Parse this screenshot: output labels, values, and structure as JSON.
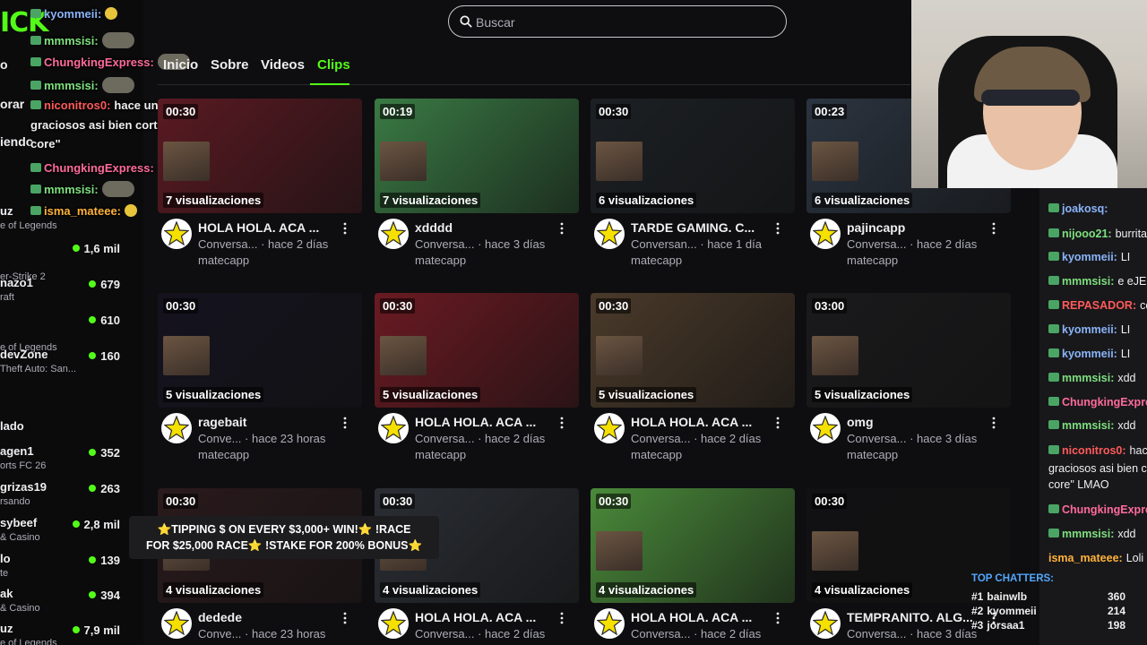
{
  "sidebar": {
    "logo_fragment": "ICK",
    "nav_fragments": [
      "o",
      "orar",
      "iendo"
    ],
    "channels": [
      {
        "name": "uz",
        "category": "e of Legends",
        "viewers": ""
      },
      {
        "name": "",
        "category": "",
        "viewers": "1,6 mil"
      },
      {
        "name": "",
        "category": "er-Strike 2",
        "viewers": ""
      },
      {
        "name": "nazo1",
        "category": "raft",
        "viewers": "679"
      },
      {
        "name": "",
        "category": "",
        "viewers": "610"
      },
      {
        "name": "",
        "category": "e of Legends",
        "viewers": ""
      },
      {
        "name": "devZone",
        "category": "Theft Auto: San...",
        "viewers": "160"
      },
      {
        "name": "lado",
        "category": "",
        "viewers": ""
      },
      {
        "name": "agen1",
        "category": "orts FC 26",
        "viewers": "352"
      },
      {
        "name": "grizas19",
        "category": "rsando",
        "viewers": "263"
      },
      {
        "name": "sybeef",
        "category": "& Casino",
        "viewers": "2,8 mil"
      },
      {
        "name": "lo",
        "category": "te",
        "viewers": "139"
      },
      {
        "name": "ak",
        "category": "& Casino",
        "viewers": "394"
      },
      {
        "name": "uz",
        "category": "e of Legends",
        "viewers": "7,9 mil"
      }
    ]
  },
  "chat_overlay": {
    "lines": [
      {
        "user": "kyommeii:",
        "color": "#8ab4f8",
        "text": ""
      },
      {
        "user": "mmmsisi:",
        "color": "#7ee07e",
        "text": ""
      },
      {
        "user": "ChungkingExpress:",
        "color": "#ff6b9a",
        "text": ""
      },
      {
        "user": "mmmsisi:",
        "color": "#7ee07e",
        "text": ""
      },
      {
        "user": "niconitros0:",
        "color": "#ff5a5a",
        "text": "hace un recopilado de clips"
      },
      {
        "user": "",
        "color": "#efeff1",
        "text": "graciosos asi bien cortados y pones \"matecap"
      },
      {
        "user": "",
        "color": "#efeff1",
        "text": "core\""
      },
      {
        "user": "ChungkingExpress:",
        "color": "#ff6b9a",
        "text": ""
      },
      {
        "user": "mmmsisi:",
        "color": "#7ee07e",
        "text": ""
      },
      {
        "user": "isma_mateee:",
        "color": "#ffb23a",
        "text": ""
      }
    ]
  },
  "search": {
    "placeholder": "Buscar"
  },
  "tabs": [
    "Inicio",
    "Sobre",
    "Videos",
    "Clips"
  ],
  "active_tab": "Clips",
  "clips": [
    {
      "duration": "00:30",
      "views": "7 visualizaciones",
      "title": "HOLA HOLA. ACA ...",
      "category": "Conversa...",
      "age": "hace 2 días",
      "channel": "matecapp",
      "bg": "#5a1a22"
    },
    {
      "duration": "00:19",
      "views": "7 visualizaciones",
      "title": "xdddd",
      "category": "Conversa...",
      "age": "hace 3 días",
      "channel": "matecapp",
      "bg": "#3a7a44"
    },
    {
      "duration": "00:30",
      "views": "6 visualizaciones",
      "title": "TARDE GAMING. C...",
      "category": "Conversan...",
      "age": "hace 1 día",
      "channel": "matecapp",
      "bg": "#1c2024"
    },
    {
      "duration": "00:23",
      "views": "6 visualizaciones",
      "title": "pajincapp",
      "category": "Conversa...",
      "age": "hace 2 días",
      "channel": "matecapp",
      "bg": "#2b3440"
    },
    {
      "duration": "00:30",
      "views": "5 visualizaciones",
      "title": "ragebait",
      "category": "Conve...",
      "age": "hace 23 horas",
      "channel": "matecapp",
      "bg": "#15121e"
    },
    {
      "duration": "00:30",
      "views": "5 visualizaciones",
      "title": "HOLA HOLA. ACA ...",
      "category": "Conversa...",
      "age": "hace 2 días",
      "channel": "matecapp",
      "bg": "#6a1a22"
    },
    {
      "duration": "00:30",
      "views": "5 visualizaciones",
      "title": "HOLA HOLA. ACA ...",
      "category": "Conversa...",
      "age": "hace 2 días",
      "channel": "matecapp",
      "bg": "#4a3a2a"
    },
    {
      "duration": "03:00",
      "views": "5 visualizaciones",
      "title": "omg",
      "category": "Conversa...",
      "age": "hace 3 días",
      "channel": "matecapp",
      "bg": "#1a1a1c"
    },
    {
      "duration": "00:30",
      "views": "4 visualizaciones",
      "title": "dedede",
      "category": "Conve...",
      "age": "hace 23 horas",
      "channel": "matecapp",
      "bg": "#2a1a1c"
    },
    {
      "duration": "00:30",
      "views": "4 visualizaciones",
      "title": "HOLA HOLA. ACA ...",
      "category": "Conversa...",
      "age": "hace 2 días",
      "channel": "matecapp",
      "bg": "#2a2e34"
    },
    {
      "duration": "00:30",
      "views": "4 visualizaciones",
      "title": "HOLA HOLA. ACA ...",
      "category": "Conversa...",
      "age": "hace 2 días",
      "channel": "matecapp",
      "bg": "#4a8a3a"
    },
    {
      "duration": "00:30",
      "views": "4 visualizaciones",
      "title": "TEMPRANITO. ALG...",
      "category": "Conversa...",
      "age": "hace 3 días",
      "channel": "matecapp",
      "bg": "#111113"
    }
  ],
  "promo": {
    "line1": "⭐TIPPING $ ON EVERY $3,000+ WIN!⭐ !RACE",
    "line2": "FOR $25,000 RACE⭐ !STAKE FOR 200% BONUS⭐"
  },
  "right_chat": {
    "messages": [
      {
        "user": "joakosq:",
        "color": "#8ab4f8",
        "text": ""
      },
      {
        "user": "nijooo21:",
        "color": "#7ee07e",
        "text": "burrita"
      },
      {
        "user": "kyommeii:",
        "color": "#8ab4f8",
        "text": "LI"
      },
      {
        "user": "mmmsisi:",
        "color": "#7ee07e",
        "text": "e eJE"
      },
      {
        "user": "REPASADOR:",
        "color": "#ff5a5a",
        "text": "co"
      },
      {
        "user": "kyommeii:",
        "color": "#8ab4f8",
        "text": "LI"
      },
      {
        "user": "kyommeii:",
        "color": "#8ab4f8",
        "text": "LI"
      },
      {
        "user": "mmmsisi:",
        "color": "#7ee07e",
        "text": "xdd"
      },
      {
        "user": "ChungkingExpre",
        "color": "#ff6b9a",
        "text": ""
      },
      {
        "user": "mmmsisi:",
        "color": "#7ee07e",
        "text": "xdd"
      },
      {
        "user": "niconitros0:",
        "color": "#ff5a5a",
        "text": "hac"
      }
    ],
    "plain_lines": [
      "graciosos asi bien c",
      "core\" LMAO"
    ],
    "messages2": [
      {
        "user": "ChungkingExpre",
        "color": "#ff6b9a",
        "text": ""
      },
      {
        "user": "mmmsisi:",
        "color": "#7ee07e",
        "text": "xdd"
      },
      {
        "user": "isma_mateee:",
        "color": "#ffb23a",
        "text": "Loli"
      }
    ]
  },
  "top_chatters": {
    "title": "TOP CHATTERS:",
    "rows": [
      {
        "rank": "#1",
        "name": "bainwlb",
        "value": "360"
      },
      {
        "rank": "#2",
        "name": "kyommeii",
        "value": "214"
      },
      {
        "rank": "#3",
        "name": "jorsaa1",
        "value": "198"
      }
    ]
  },
  "colors": {
    "accent": "#53fc18",
    "bg": "#0e0e10",
    "text": "#efeff1",
    "muted": "#adadb8"
  }
}
